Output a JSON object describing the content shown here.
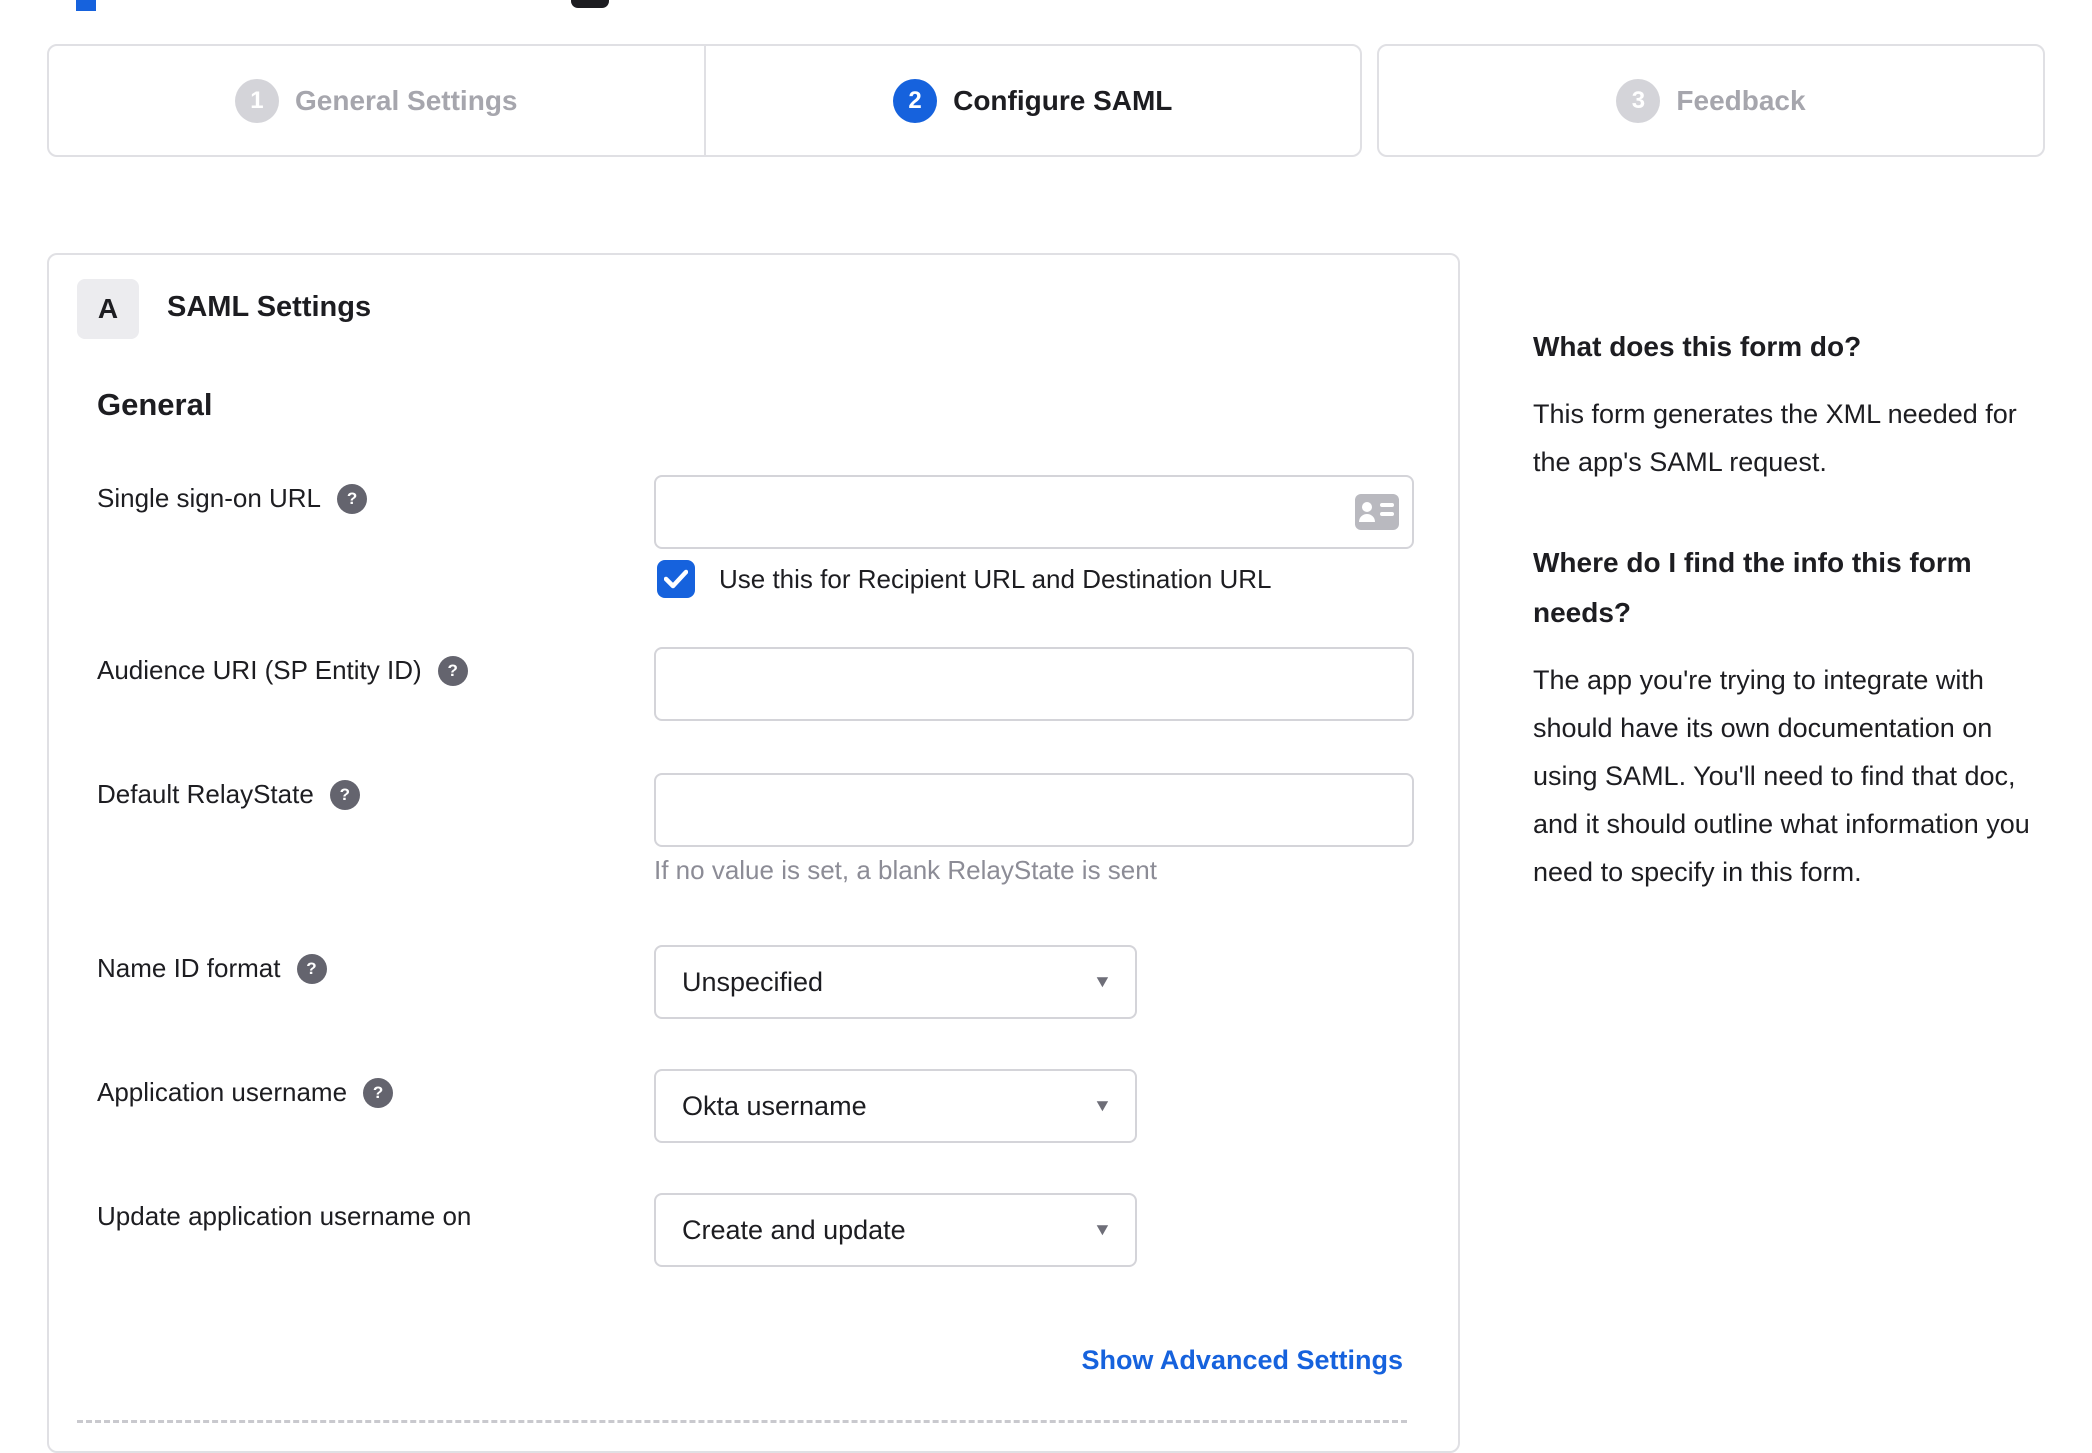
{
  "colors": {
    "accent_blue": "#1662dd",
    "text_dark": "#1d1d21",
    "muted_gray": "#8c8c96",
    "border_gray": "#e0e0e4",
    "step_inactive": "#d4d4d9"
  },
  "stepper": {
    "active_step": "2",
    "steps": [
      {
        "number": "1",
        "label": "General Settings"
      },
      {
        "number": "2",
        "label": "Configure SAML"
      },
      {
        "number": "3",
        "label": "Feedback"
      }
    ]
  },
  "panel": {
    "badge": "A",
    "title": "SAML Settings",
    "section_heading": "General"
  },
  "help_icon": "?",
  "fields": {
    "sso": {
      "label": "Single sign-on URL",
      "value": "",
      "checkbox_label": "Use this for Recipient URL and Destination URL",
      "checkbox_checked": true
    },
    "audience": {
      "label": "Audience URI (SP Entity ID)",
      "value": ""
    },
    "relay": {
      "label": "Default RelayState",
      "value": "",
      "hint": "If no value is set, a blank RelayState is sent"
    },
    "name_id": {
      "label": "Name ID format",
      "value": "Unspecified"
    },
    "app_username": {
      "label": "Application username",
      "value": "Okta username"
    },
    "update_username": {
      "label": "Update application username on",
      "value": "Create and update"
    }
  },
  "actions": {
    "advanced_link": "Show Advanced Settings"
  },
  "sidebar": {
    "sections": [
      {
        "heading": "What does this form do?",
        "body": "This form generates the XML needed for the app's SAML request."
      },
      {
        "heading": "Where do I find the info this form needs?",
        "body": "The app you're trying to integrate with should have its own documentation on using SAML. You'll need to find that doc, and it should outline what information you need to specify in this form."
      }
    ]
  }
}
